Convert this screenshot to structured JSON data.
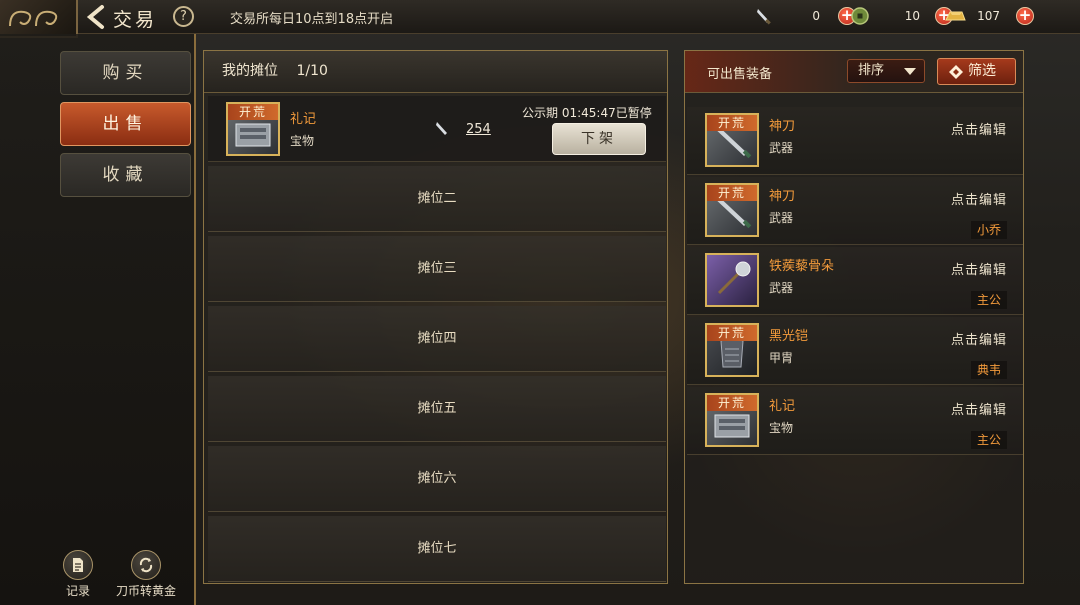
{
  "topbar": {
    "title": "交易",
    "help_label": "?",
    "notice": "交易所每日10点到18点开启",
    "currencies": [
      {
        "icon": "blade-coin-icon",
        "amount": "0"
      },
      {
        "icon": "jade-coin-icon",
        "amount": "10"
      },
      {
        "icon": "gold-ingot-icon",
        "amount": "107"
      }
    ],
    "plus_label": "+"
  },
  "leftnav": {
    "items": [
      {
        "label": "购买",
        "active": false
      },
      {
        "label": "出售",
        "active": true
      },
      {
        "label": "收藏",
        "active": false
      }
    ],
    "tools": [
      {
        "label": "记录",
        "icon": "record-icon"
      },
      {
        "label": "刀币转黄金",
        "icon": "exchange-icon"
      }
    ]
  },
  "my_stalls": {
    "title": "我的摊位",
    "count": "1/10",
    "listed": {
      "tag": "开荒",
      "name": "礼记",
      "type": "宝物",
      "price": "254",
      "timer": "公示期 01:45:47已暂停",
      "delist_label": "下架"
    },
    "empty_slots": [
      "摊位二",
      "摊位三",
      "摊位四",
      "摊位五",
      "摊位六",
      "摊位七"
    ]
  },
  "sellable": {
    "title": "可出售装备",
    "sort_label": "排序",
    "filter_label": "筛选",
    "edit_label": "点击编辑",
    "items": [
      {
        "tag": "开荒",
        "name": "神刀",
        "type": "武器",
        "owner": "",
        "art": "blade"
      },
      {
        "tag": "开荒",
        "name": "神刀",
        "type": "武器",
        "owner": "小乔",
        "art": "blade"
      },
      {
        "tag": "",
        "name": "铁蒺藜骨朵",
        "type": "武器",
        "owner": "主公",
        "art": "mace"
      },
      {
        "tag": "开荒",
        "name": "黑光铠",
        "type": "甲胄",
        "owner": "典韦",
        "art": "armor"
      },
      {
        "tag": "开荒",
        "name": "礼记",
        "type": "宝物",
        "owner": "主公",
        "art": "book"
      }
    ]
  },
  "colors": {
    "accent_orange": "#f29a3b",
    "active_tab": "#c85a2c",
    "frame_gold": "#8b7444"
  }
}
